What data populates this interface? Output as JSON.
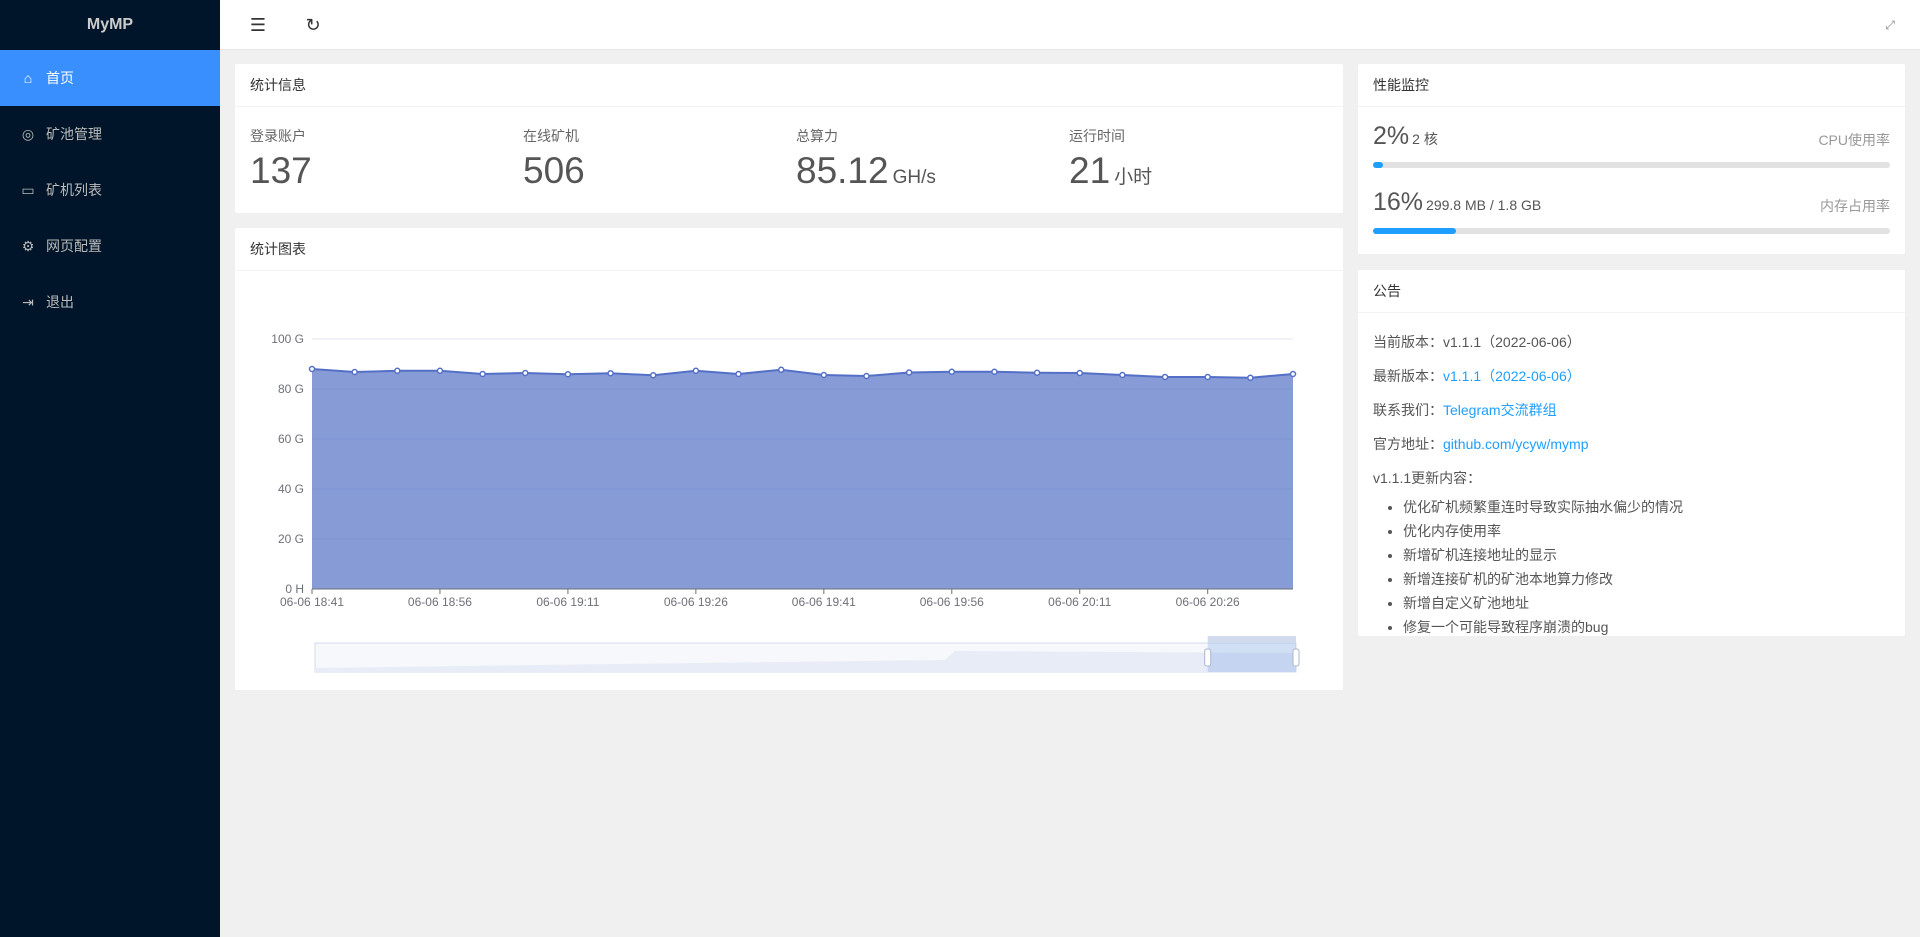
{
  "app": {
    "title": "MyMP"
  },
  "sidebar": {
    "items": [
      {
        "label": "首页",
        "icon": "home-icon",
        "active": true
      },
      {
        "label": "矿池管理",
        "icon": "pool-icon"
      },
      {
        "label": "矿机列表",
        "icon": "monitor-icon"
      },
      {
        "label": "网页配置",
        "icon": "gear-icon"
      },
      {
        "label": "退出",
        "icon": "logout-icon"
      }
    ]
  },
  "topbar": {
    "icons": [
      "menu-fold-icon",
      "refresh-icon",
      "fullscreen-icon"
    ]
  },
  "stats": {
    "title": "统计信息",
    "items": [
      {
        "label": "登录账户",
        "value": "137",
        "unit": ""
      },
      {
        "label": "在线矿机",
        "value": "506",
        "unit": ""
      },
      {
        "label": "总算力",
        "value": "85.12",
        "unit": "GH/s"
      },
      {
        "label": "运行时间",
        "value": "21",
        "unit": "小时"
      }
    ]
  },
  "chart_card": {
    "title": "统计图表"
  },
  "chart_data": {
    "type": "area",
    "x": [
      "06-06 18:41",
      "06-06 18:46",
      "06-06 18:51",
      "06-06 18:56",
      "06-06 19:01",
      "06-06 19:06",
      "06-06 19:11",
      "06-06 19:16",
      "06-06 19:21",
      "06-06 19:26",
      "06-06 19:31",
      "06-06 19:36",
      "06-06 19:41",
      "06-06 19:46",
      "06-06 19:51",
      "06-06 19:56",
      "06-06 20:01",
      "06-06 20:06",
      "06-06 20:11",
      "06-06 20:16",
      "06-06 20:21",
      "06-06 20:26",
      "06-06 20:31",
      "06-06 20:36"
    ],
    "series": [
      {
        "values": [
          88.0,
          86.8,
          87.3,
          87.3,
          86.0,
          86.4,
          85.9,
          86.3,
          85.5,
          87.3,
          86.0,
          87.7,
          85.6,
          85.2,
          86.6,
          86.9,
          86.9,
          86.5,
          86.4,
          85.6,
          84.8,
          84.8,
          84.5,
          86.0
        ],
        "color": "#5470c6"
      }
    ],
    "ylim": [
      0,
      100
    ],
    "yticks": [
      "0 H",
      "20 G",
      "40 G",
      "60 G",
      "80 G",
      "100 G"
    ],
    "xticks": [
      "06-06 18:41",
      "06-06 18:56",
      "06-06 19:11",
      "06-06 19:26",
      "06-06 19:41",
      "06-06 19:56",
      "06-06 20:11",
      "06-06 20:26"
    ],
    "grid": true,
    "datazoom": {
      "start_percent": 91,
      "end_percent": 100
    }
  },
  "perf": {
    "title": "性能监控",
    "cpu": {
      "percent": "2%",
      "detail": "2 核",
      "label": "CPU使用率",
      "fill": 2
    },
    "mem": {
      "percent": "16%",
      "detail": "299.8 MB / 1.8 GB",
      "label": "内存占用率",
      "fill": 16
    }
  },
  "notice": {
    "title": "公告",
    "current_label": "当前版本：",
    "current": "v1.1.1（2022-06-06）",
    "latest_label": "最新版本：",
    "latest": "v1.1.1（2022-06-06）",
    "contact_label": "联系我们：",
    "contact": "Telegram交流群组",
    "site_label": "官方地址：",
    "site": "github.com/ycyw/mymp",
    "changelog_title": "v1.1.1更新内容：",
    "changes": [
      "优化矿机频繁重连时导致实际抽水偏少的情况",
      "优化内存使用率",
      "新增矿机连接地址的显示",
      "新增连接矿机的矿池本地算力修改",
      "新增自定义矿池地址",
      "修复一个可能导致程序崩溃的bug"
    ]
  }
}
